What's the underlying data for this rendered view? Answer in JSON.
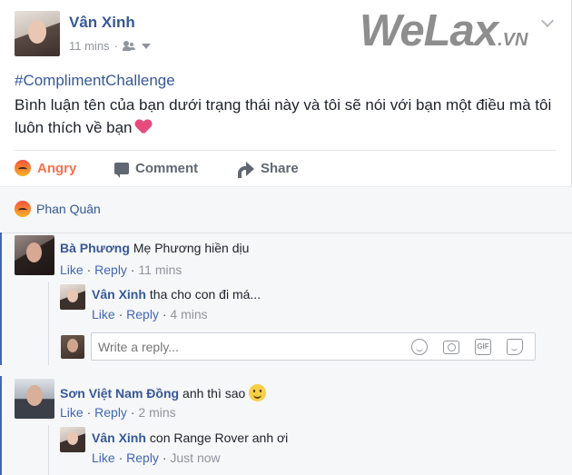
{
  "post": {
    "author": "Vân Xinh",
    "time": "11 mins",
    "watermark_main": "WeLax",
    "watermark_suffix": ".VN",
    "hashtag": "#ComplimentChallenge",
    "text": "Bình luận tên của bạn dưới trạng thái này và tôi sẽ nói với bạn một điều mà tôi luôn thích về bạn",
    "icons": {
      "privacy": "friends-icon",
      "heart": "heart-emoji"
    }
  },
  "actions": {
    "angry": "Angry",
    "comment": "Comment",
    "share": "Share"
  },
  "reactions": {
    "reactor": "Phan Quân"
  },
  "comments": [
    {
      "author": "Bà Phương",
      "text": "Mẹ Phương hiền dịu",
      "like": "Like",
      "reply": "Reply",
      "time": "11 mins",
      "replies": [
        {
          "author": "Vân Xinh",
          "text": "tha cho con đi má...",
          "like": "Like",
          "reply": "Reply",
          "time": "4 mins"
        }
      ]
    },
    {
      "author": "Sơn Việt Nam Đồng",
      "text": "anh thì sao",
      "like": "Like",
      "reply": "Reply",
      "time": "2 mins",
      "replies": [
        {
          "author": "Vân Xinh",
          "text": "con Range Rover anh ơi",
          "like": "Like",
          "reply": "Reply",
          "time": "Just now"
        }
      ]
    }
  ],
  "reply_box": {
    "placeholder": "Write a reply...",
    "gif_label": "GIF"
  },
  "colors": {
    "link": "#365899",
    "angry": "#f7714c",
    "heart": "#e64b7c",
    "thread_bar": "#4267b2"
  }
}
